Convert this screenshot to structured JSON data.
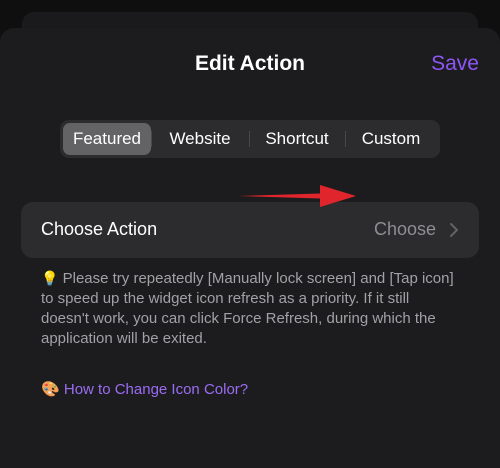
{
  "sheet": {
    "title": "Edit Action",
    "save_label": "Save"
  },
  "tabs": [
    {
      "label": "Featured",
      "active": true
    },
    {
      "label": "Website",
      "active": false
    },
    {
      "label": "Shortcut",
      "active": false
    },
    {
      "label": "Custom",
      "active": false
    }
  ],
  "action_row": {
    "label": "Choose Action",
    "value": "Choose"
  },
  "tip": {
    "icon": "💡",
    "text": "Please try repeatedly [Manually lock screen] and [Tap icon] to speed up the widget icon refresh as a priority. If it still doesn't work, you can click Force Refresh, during which the application will be exited."
  },
  "help_link": {
    "icon": "🎨",
    "text": "How to Change Icon Color?"
  },
  "colors": {
    "accent": "#8e55f7",
    "annotation_arrow": "#e0262c"
  }
}
